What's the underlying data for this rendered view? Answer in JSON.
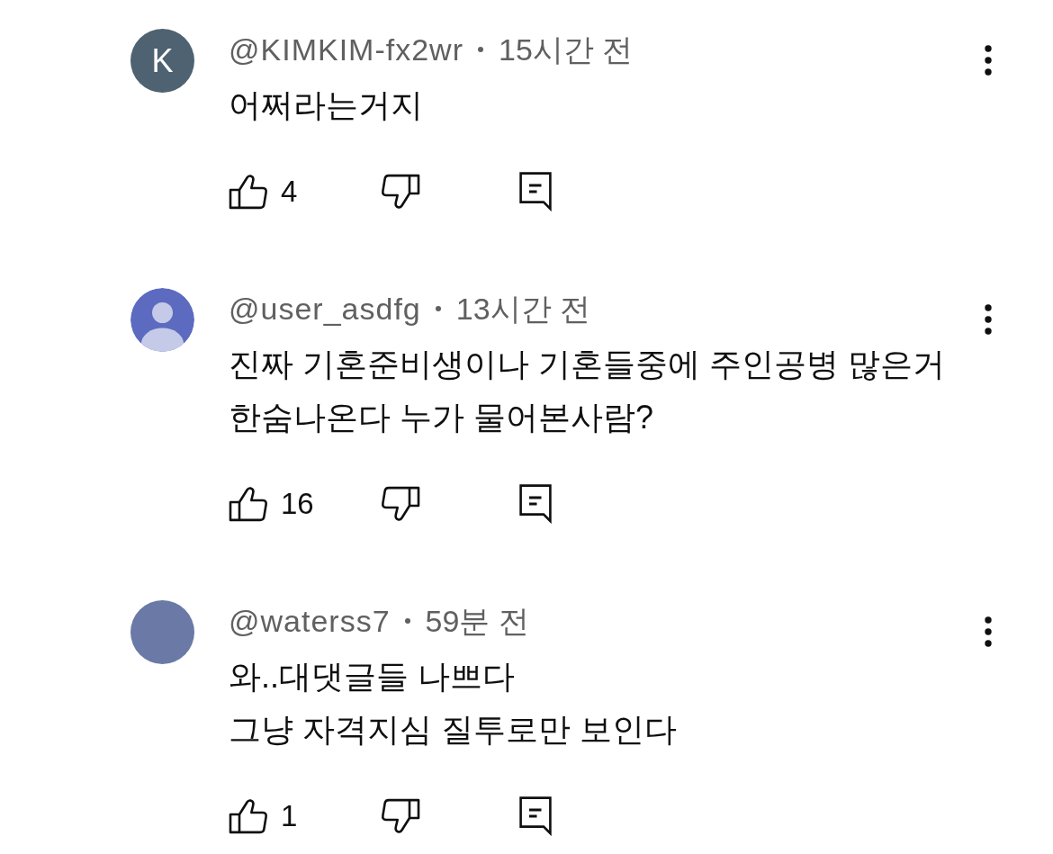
{
  "comments": [
    {
      "avatar": {
        "kind": "letter",
        "letter": "K",
        "color": "#4e6271"
      },
      "author": "@KIMKIM-fx2wr",
      "time": "15시간 전",
      "text": "어쩌라는거지",
      "likes": "4"
    },
    {
      "avatar": {
        "kind": "silhouette",
        "color": "#5c6bc0"
      },
      "author": "@user_asdfg",
      "time": "13시간 전",
      "text": "진짜 기혼준비생이나 기혼들중에 주인공병 많은거\n한숨나온다 누가 물어본사람?",
      "likes": "16"
    },
    {
      "avatar": {
        "kind": "photo",
        "color": "#6a79a6"
      },
      "author": "@waterss7",
      "time": "59분 전",
      "text": "와..대댓글들 나쁘다\n그냥 자격지심 질투로만 보인다",
      "likes": "1"
    }
  ]
}
